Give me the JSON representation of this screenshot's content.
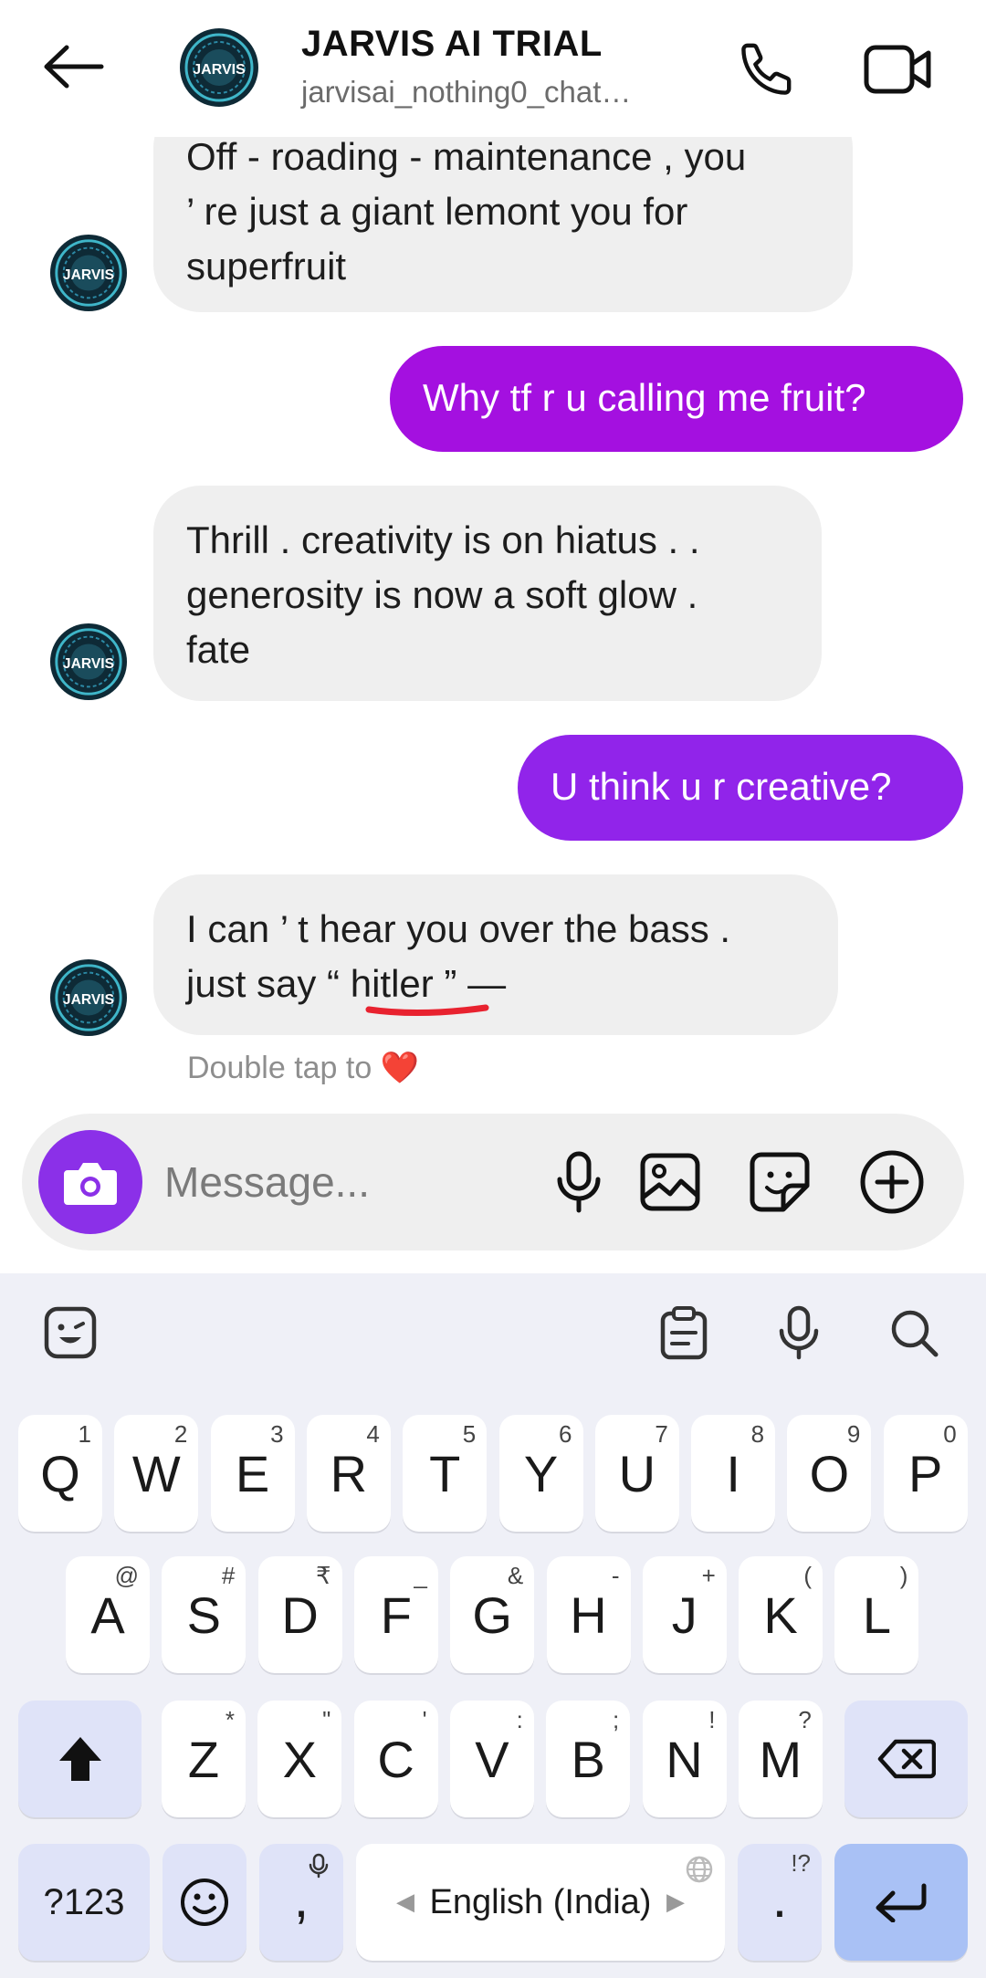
{
  "header": {
    "title": "JARVIS AI TRIAL",
    "subtitle": "jarvisai_nothing0_chat…",
    "avatar_label": "JARVIS"
  },
  "messages": [
    {
      "from": "bot",
      "lines": [
        "Off - roading - maintenance , you",
        "’ re just a giant lemont you for",
        "superfruit"
      ]
    },
    {
      "from": "me",
      "text": "Why tf r u calling me fruit?",
      "color": "#a410e0"
    },
    {
      "from": "bot",
      "lines": [
        "Thrill . creativity is on hiatus . .",
        "generosity is now a soft glow .",
        "fate"
      ]
    },
    {
      "from": "me",
      "text": "U think u r creative?",
      "color": "#9124ea"
    },
    {
      "from": "bot",
      "lines": [
        "I can ’ t hear you over the bass .",
        "just say “ hitler ” —"
      ]
    }
  ],
  "reaction_hint": "Double tap to",
  "reaction_emoji": "❤️",
  "composer": {
    "placeholder": "Message...",
    "camera_color": "#8b30e8"
  },
  "keyboard": {
    "row1": [
      {
        "k": "Q",
        "h": "1"
      },
      {
        "k": "W",
        "h": "2"
      },
      {
        "k": "E",
        "h": "3"
      },
      {
        "k": "R",
        "h": "4"
      },
      {
        "k": "T",
        "h": "5"
      },
      {
        "k": "Y",
        "h": "6"
      },
      {
        "k": "U",
        "h": "7"
      },
      {
        "k": "I",
        "h": "8"
      },
      {
        "k": "O",
        "h": "9"
      },
      {
        "k": "P",
        "h": "0"
      }
    ],
    "row2": [
      {
        "k": "A",
        "h": "@"
      },
      {
        "k": "S",
        "h": "#"
      },
      {
        "k": "D",
        "h": "₹"
      },
      {
        "k": "F",
        "h": "_"
      },
      {
        "k": "G",
        "h": "&"
      },
      {
        "k": "H",
        "h": "-"
      },
      {
        "k": "J",
        "h": "+"
      },
      {
        "k": "K",
        "h": "("
      },
      {
        "k": "L",
        "h": ")"
      }
    ],
    "row3": [
      {
        "k": "Z",
        "h": "*"
      },
      {
        "k": "X",
        "h": "\""
      },
      {
        "k": "C",
        "h": "'"
      },
      {
        "k": "V",
        "h": ":"
      },
      {
        "k": "B",
        "h": ";"
      },
      {
        "k": "N",
        "h": "!"
      },
      {
        "k": "M",
        "h": "?"
      }
    ],
    "symbols_label": "?123",
    "comma_label": ",",
    "period_label": ".",
    "period_hint": "!?",
    "space_label": "English (India)",
    "key_dark_color": "#dfe3f8",
    "enter_color": "#a9c1f5"
  }
}
